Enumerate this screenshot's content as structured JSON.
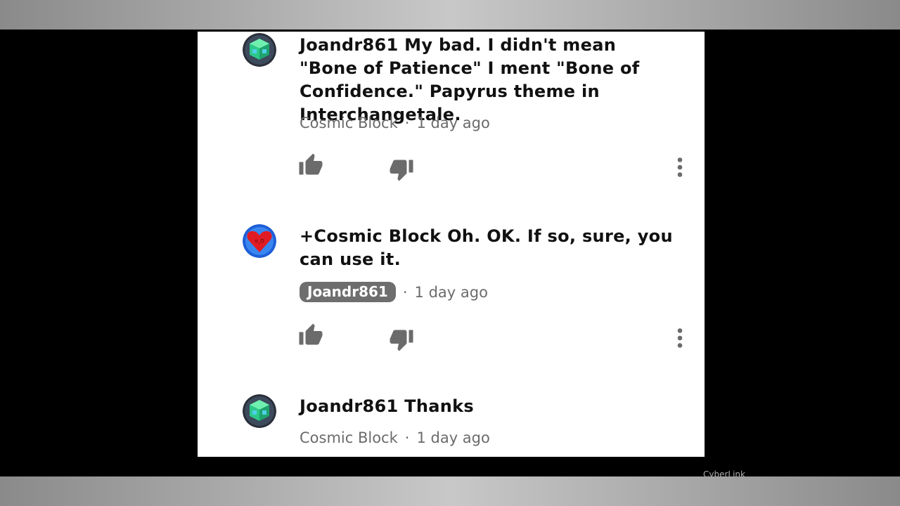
{
  "comments": [
    {
      "text": "Joandr861 My bad. I didn't mean \"Bone of Patience\" I ment \"Bone of Confidence.\" Papyrus theme in Interchangetale.",
      "author": "Cosmic Block",
      "author_style": "plain",
      "separator": "·",
      "time": "1 day ago",
      "avatar_icon": "green-cube-avatar",
      "actions": [
        "thumbs-up-icon",
        "thumbs-down-icon",
        "more-vert-icon"
      ]
    },
    {
      "text": "+Cosmic Block Oh. OK. If so, sure, you can use it.",
      "author": "Joandr861",
      "author_style": "badge",
      "separator": "·",
      "time": "1 day ago",
      "avatar_icon": "red-heart-avatar",
      "actions": [
        "thumbs-up-icon",
        "thumbs-down-icon",
        "more-vert-icon"
      ]
    },
    {
      "text": "Joandr861 Thanks",
      "author": "Cosmic Block",
      "author_style": "plain",
      "separator": "·",
      "time": "1 day ago",
      "avatar_icon": "green-cube-avatar"
    }
  ],
  "watermark": "CyberLink",
  "colors": {
    "panel_bg": "#ffffff",
    "text": "#111111",
    "meta_text": "#6b6b6b",
    "badge_bg": "#6e6e6e",
    "icon": "#6b6b6b"
  }
}
